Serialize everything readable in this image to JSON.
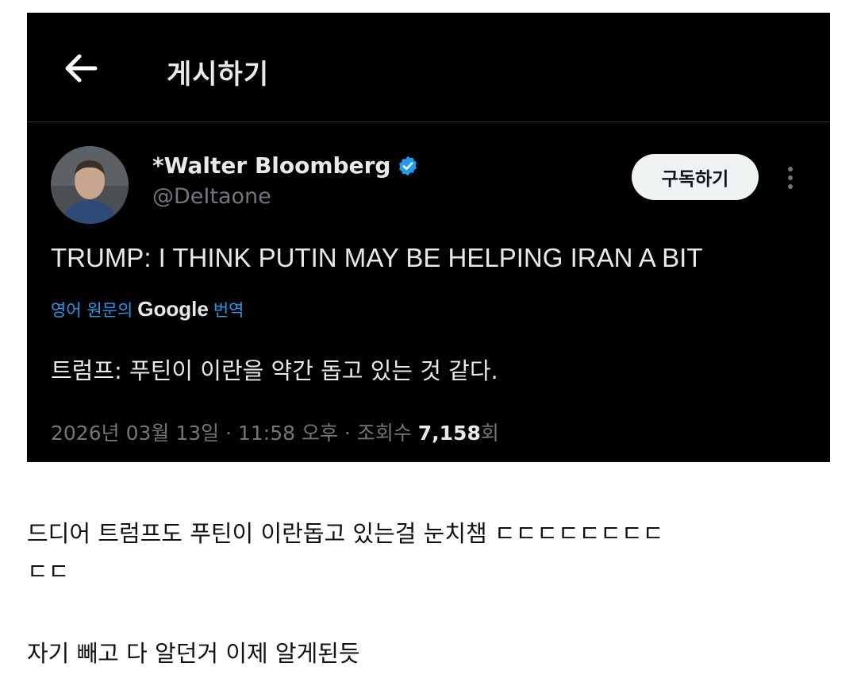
{
  "header": {
    "title": "게시하기",
    "back_icon": "arrow-left-icon"
  },
  "tweet": {
    "author": {
      "display_name": "*Walter Bloomberg",
      "handle": "@DeItaone",
      "verified_icon": "verified-badge-icon",
      "verified_color": "#1d9bf0"
    },
    "subscribe_label": "구독하기",
    "more_icon": "more-vertical-icon",
    "text": "TRUMP: I THINK PUTIN MAY BE HELPING IRAN A BIT",
    "translate": {
      "prefix": "영어 원문의",
      "brand": "Google",
      "suffix": "번역"
    },
    "translation": "트럼프: 푸틴이 이란을 약간 돕고 있는 것 같다.",
    "meta": {
      "timestamp": "2026년 03월 13일 · 11:58 오후 · 조회수 ",
      "views": "7,158",
      "views_suffix": "회"
    }
  },
  "post": {
    "line1": "드디어 트럼프도 푸틴이 이란돕고 있는걸 눈치챔 ㄷㄷㄷㄷㄷㄷㄷㄷ\nㄷㄷ",
    "line2": "자기 빼고 다 알던거 이제 알게된듯"
  },
  "colors": {
    "screen_bg": "#000000",
    "page_bg": "#ffffff",
    "accent": "#1d9bf0",
    "muted": "#71767b"
  }
}
